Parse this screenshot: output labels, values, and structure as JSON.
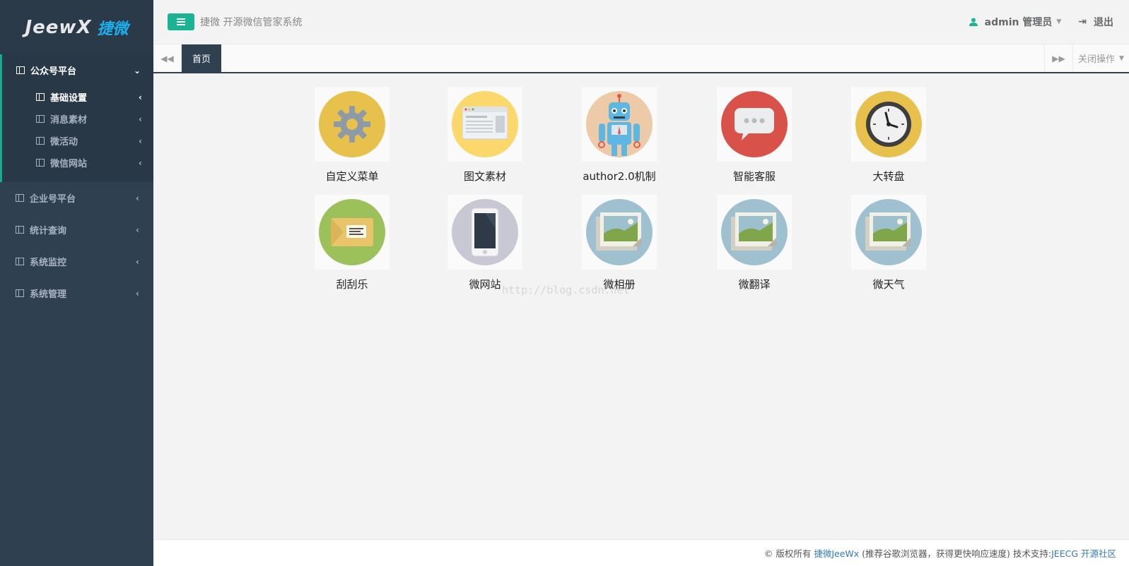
{
  "logo": {
    "text": "JeewX",
    "cn": "捷微"
  },
  "sidebar": {
    "active_group": {
      "label": "公众号平台",
      "chevron": "⌄"
    },
    "sub_items": [
      {
        "label": "基础设置",
        "active": true
      },
      {
        "label": "消息素材",
        "active": false
      },
      {
        "label": "微活动",
        "active": false
      },
      {
        "label": "微信网站",
        "active": false
      }
    ],
    "items": [
      {
        "label": "企业号平台"
      },
      {
        "label": "统计查询"
      },
      {
        "label": "系统监控"
      },
      {
        "label": "系统管理"
      }
    ],
    "chevron_left": "‹"
  },
  "header": {
    "system_title": "捷微  开源微信管家系统",
    "user_label": "admin 管理员",
    "logout_label": "退出"
  },
  "tabs": {
    "active_tab": "首页",
    "close_ops": "关闭操作"
  },
  "apps": [
    {
      "name": "自定义菜单",
      "icon": "gear-icon",
      "color": "#e8c14d"
    },
    {
      "name": "图文素材",
      "icon": "browser-window-icon",
      "color": "#fbd86b"
    },
    {
      "name": "author2.0机制",
      "icon": "robot-icon",
      "color": "#eecba8"
    },
    {
      "name": "智能客服",
      "icon": "chat-bubble-icon",
      "color": "#d8524a"
    },
    {
      "name": "大转盘",
      "icon": "clock-icon",
      "color": "#e8c14d"
    },
    {
      "name": "刮刮乐",
      "icon": "ticket-icon",
      "color": "#9cc05a"
    },
    {
      "name": "微网站",
      "icon": "phone-icon",
      "color": "#c7c8d4"
    },
    {
      "name": "微相册",
      "icon": "picture-icon",
      "color": "#9fc1cf"
    },
    {
      "name": "微翻译",
      "icon": "picture-icon",
      "color": "#9fc1cf"
    },
    {
      "name": "微天气",
      "icon": "picture-icon",
      "color": "#9fc1cf"
    }
  ],
  "watermark": "http://blog.csdn.net",
  "footer": {
    "prefix": "© 版权所有",
    "brand": "捷微JeeWx",
    "middle": "(推荐谷歌浏览器，获得更快响应速度) 技术支持:",
    "support": "JEECG 开源社区"
  }
}
